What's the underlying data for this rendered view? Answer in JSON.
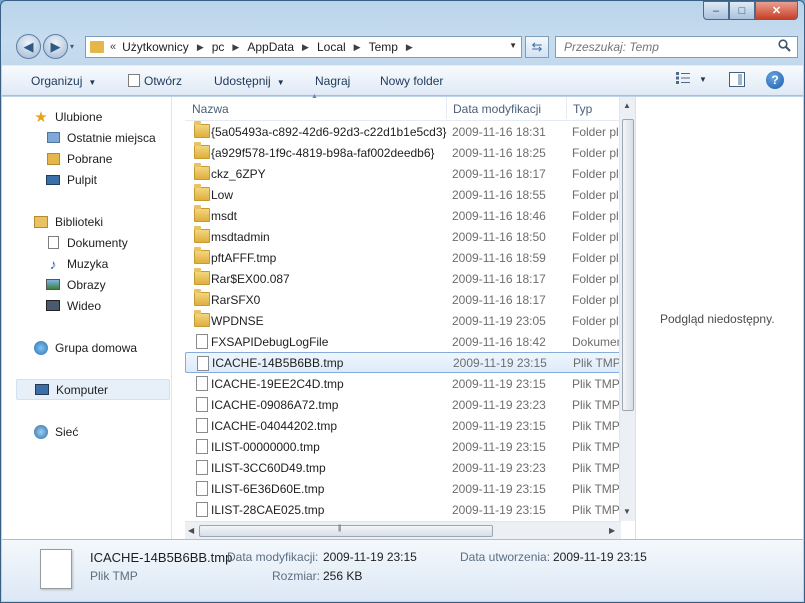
{
  "window": {
    "caption": {
      "minimize": "–",
      "maximize": "□",
      "close": "✕"
    }
  },
  "navigation": {
    "back": "◀",
    "forward": "▶",
    "recent": "▾"
  },
  "address": {
    "first_sep": "«",
    "crumbs": [
      "Użytkownicy",
      "pc",
      "AppData",
      "Local",
      "Temp"
    ],
    "separator": "▶",
    "dropdown": "▼"
  },
  "refresh": "⇆",
  "search": {
    "placeholder": "Przeszukaj: Temp",
    "icon": "search-icon"
  },
  "toolbar": {
    "organize": "Organizuj",
    "open": "Otwórz",
    "share": "Udostępnij",
    "burn": "Nagraj",
    "new_folder": "Nowy folder",
    "views_icon": "views-icon",
    "preview_icon": "preview-pane-icon",
    "help": "?"
  },
  "sidebar": {
    "favorites": {
      "label": "Ulubione",
      "items": [
        "Ostatnie miejsca",
        "Pobrane",
        "Pulpit"
      ]
    },
    "libraries": {
      "label": "Biblioteki",
      "items": [
        "Dokumenty",
        "Muzyka",
        "Obrazy",
        "Wideo"
      ]
    },
    "homegroup": "Grupa domowa",
    "computer": "Komputer",
    "network": "Sieć"
  },
  "columns": {
    "name": "Nazwa",
    "date": "Data modyfikacji",
    "type": "Typ"
  },
  "files": [
    {
      "name": "{5a05493a-c892-42d6-92d3-c22d1b1e5cd3}",
      "date": "2009-11-16 18:31",
      "type": "Folder plików",
      "kind": "folder"
    },
    {
      "name": "{a929f578-1f9c-4819-b98a-faf002deedb6}",
      "date": "2009-11-16 18:25",
      "type": "Folder plików",
      "kind": "folder"
    },
    {
      "name": "ckz_6ZPY",
      "date": "2009-11-16 18:17",
      "type": "Folder plików",
      "kind": "folder"
    },
    {
      "name": "Low",
      "date": "2009-11-16 18:55",
      "type": "Folder plików",
      "kind": "folder"
    },
    {
      "name": "msdt",
      "date": "2009-11-16 18:46",
      "type": "Folder plików",
      "kind": "folder"
    },
    {
      "name": "msdtadmin",
      "date": "2009-11-16 18:50",
      "type": "Folder plików",
      "kind": "folder"
    },
    {
      "name": "pftAFFF.tmp",
      "date": "2009-11-16 18:59",
      "type": "Folder plików",
      "kind": "folder"
    },
    {
      "name": "Rar$EX00.087",
      "date": "2009-11-16 18:17",
      "type": "Folder plików",
      "kind": "folder"
    },
    {
      "name": "RarSFX0",
      "date": "2009-11-16 18:17",
      "type": "Folder plików",
      "kind": "folder"
    },
    {
      "name": "WPDNSE",
      "date": "2009-11-19 23:05",
      "type": "Folder plików",
      "kind": "folder"
    },
    {
      "name": "FXSAPIDebugLogFile",
      "date": "2009-11-16 18:42",
      "type": "Dokument tekstowy",
      "kind": "file"
    },
    {
      "name": "ICACHE-14B5B6BB.tmp",
      "date": "2009-11-19 23:15",
      "type": "Plik TMP",
      "kind": "file",
      "selected": true
    },
    {
      "name": "ICACHE-19EE2C4D.tmp",
      "date": "2009-11-19 23:15",
      "type": "Plik TMP",
      "kind": "file"
    },
    {
      "name": "ICACHE-09086A72.tmp",
      "date": "2009-11-19 23:23",
      "type": "Plik TMP",
      "kind": "file"
    },
    {
      "name": "ICACHE-04044202.tmp",
      "date": "2009-11-19 23:15",
      "type": "Plik TMP",
      "kind": "file"
    },
    {
      "name": "ILIST-00000000.tmp",
      "date": "2009-11-19 23:15",
      "type": "Plik TMP",
      "kind": "file"
    },
    {
      "name": "ILIST-3CC60D49.tmp",
      "date": "2009-11-19 23:23",
      "type": "Plik TMP",
      "kind": "file"
    },
    {
      "name": "ILIST-6E36D60E.tmp",
      "date": "2009-11-19 23:15",
      "type": "Plik TMP",
      "kind": "file"
    },
    {
      "name": "ILIST-28CAE025.tmp",
      "date": "2009-11-19 23:15",
      "type": "Plik TMP",
      "kind": "file"
    }
  ],
  "scrollbars": {
    "up": "▲",
    "down": "▼",
    "left": "◀",
    "right": "▶",
    "grip": "|||"
  },
  "preview": {
    "text": "Podgląd niedostępny."
  },
  "details": {
    "filename": "ICACHE-14B5B6BB.tmp",
    "filetype": "Plik TMP",
    "modified_label": "Data modyfikacji:",
    "modified_value": "2009-11-19 23:15",
    "size_label": "Rozmiar:",
    "size_value": "256 KB",
    "created_label": "Data utworzenia:",
    "created_value": "2009-11-19 23:15"
  }
}
